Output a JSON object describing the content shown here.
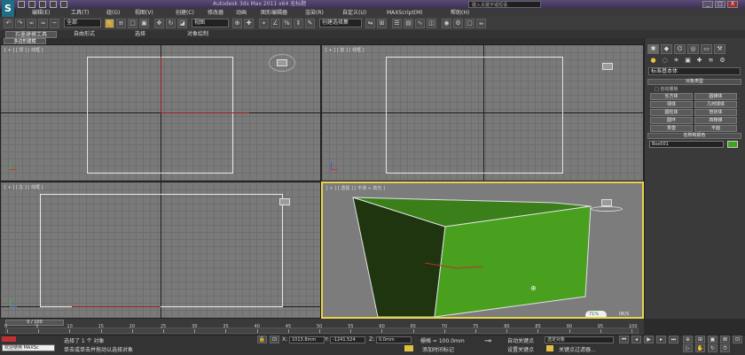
{
  "window": {
    "title": "Autodesk 3ds Max  2011 x64    无标题",
    "search_placeholder": "键入关键字或短语",
    "minimize": "_",
    "maximize": "□",
    "close": "X"
  },
  "menu": [
    "编辑(E)",
    "工具(T)",
    "组(G)",
    "视图(V)",
    "创建(C)",
    "修改器",
    "动画",
    "图形编辑器",
    "渲染(R)",
    "自定义(U)",
    "MAXScript(M)",
    "帮助(H)"
  ],
  "toolbar": {
    "filter_select": "全部",
    "ref_coord_select": "视图",
    "named_selection": "创建选择集",
    "snap_label": "3",
    "angle_snap_label": "4%"
  },
  "ribbon": {
    "tabs": [
      "石墨建模工具",
      "自由形式",
      "选择",
      "对象绘制"
    ],
    "sub_tab": "多边形建模"
  },
  "viewports": [
    {
      "label": "[ + ] [ 顶 ] [ 线框 ]"
    },
    {
      "label": "[ + ] [ 前 ] [ 线框 ]"
    },
    {
      "label": "[ + ] [ 左 ] [ 线框 ]"
    },
    {
      "label": "[ + ] [ 透视 ] [ 平滑 + 高光 ]"
    }
  ],
  "perspective_stats": {
    "pct": "71%",
    "fps1": "0K/S",
    "fps2": "0K/S"
  },
  "command_panel": {
    "category_select": "标准基本体",
    "rollout_object_type": "对象类型",
    "autogrid": "自动栅格",
    "buttons": [
      "长方体",
      "圆锥体",
      "球体",
      "几何球体",
      "圆柱体",
      "管状体",
      "圆环",
      "四棱锥",
      "茶壶",
      "平面"
    ],
    "rollout_name_color": "名称和颜色",
    "object_name": "Box001",
    "object_color": "#3fa31c"
  },
  "timeline": {
    "frame_display": "0 / 100",
    "ticks": [
      "0",
      "5",
      "10",
      "15",
      "20",
      "25",
      "30",
      "35",
      "40",
      "45",
      "50",
      "55",
      "60",
      "65",
      "70",
      "75",
      "80",
      "85",
      "90",
      "95",
      "100"
    ]
  },
  "status": {
    "welcome": "欢迎使用 MAXSc",
    "selection_info": "选择了 1 个 对象",
    "prompt": "单击或单击并拖动以选择对象",
    "x_label": "X:",
    "x_value": "1013.8mm",
    "y_label": "Y:",
    "y_value": "-1241.524",
    "z_label": "Z:",
    "z_value": "0.0mm",
    "grid": "栅格 = 100.0mm",
    "add_time_tag": "添加时间标记",
    "auto_key": "自动关键点",
    "set_key": "设置关键点",
    "selected_object": "选定对象",
    "key_filters": "关键点过滤器..."
  }
}
